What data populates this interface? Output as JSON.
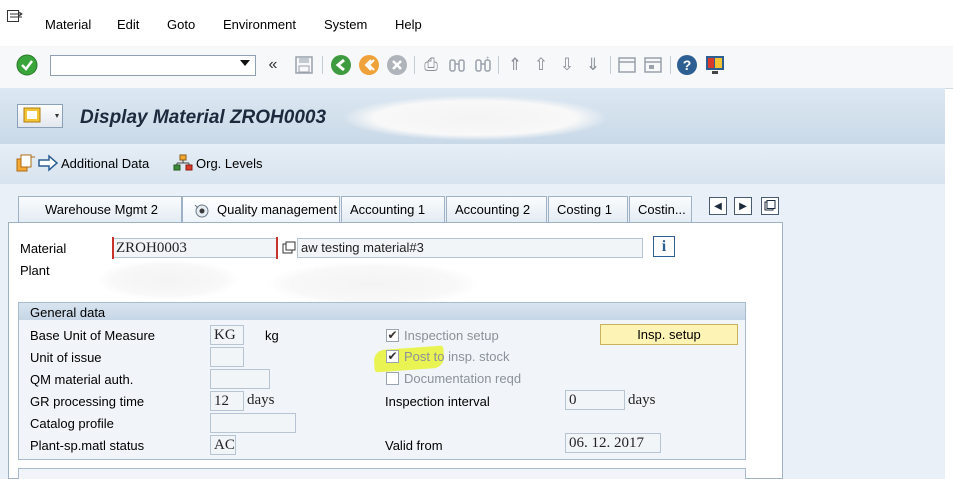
{
  "menu": {
    "items": [
      {
        "label": "Material"
      },
      {
        "label": "Edit"
      },
      {
        "label": "Goto"
      },
      {
        "label": "Environment"
      },
      {
        "label": "System"
      },
      {
        "label": "Help"
      }
    ]
  },
  "toolbar": {
    "command_field_value": "",
    "back_glyph": "«"
  },
  "title": {
    "text": "Display Material ZROH0003"
  },
  "app_toolbar": {
    "additional_data_label": "Additional Data",
    "org_levels_label": "Org. Levels"
  },
  "tabs": [
    {
      "label": "Warehouse Mgmt 2",
      "active": false
    },
    {
      "label": "Quality management",
      "active": true
    },
    {
      "label": "Accounting 1",
      "active": false
    },
    {
      "label": "Accounting 2",
      "active": false
    },
    {
      "label": "Costing 1",
      "active": false
    },
    {
      "label": "Costin...",
      "active": false
    }
  ],
  "header_fields": {
    "material_label": "Material",
    "material_value": "ZROH0003",
    "material_desc": "aw testing material#3",
    "plant_label": "Plant"
  },
  "general_data": {
    "title": "General data",
    "base_uom_label": "Base Unit of Measure",
    "base_uom_value": "KG",
    "base_uom_text": "kg",
    "unit_issue_label": "Unit of issue",
    "unit_issue_value": "",
    "qm_auth_label": "QM material auth.",
    "qm_auth_value": "",
    "gr_time_label": "GR processing time",
    "gr_time_value": "12",
    "gr_time_unit": "days",
    "catalog_label": "Catalog profile",
    "catalog_value": "",
    "status_label": "Plant-sp.matl status",
    "status_value": "AC",
    "insp_setup_cb_label": "Inspection setup",
    "insp_setup_checked": true,
    "post_insp_label": "Post to insp. stock",
    "post_insp_checked": true,
    "doc_reqd_label": "Documentation reqd",
    "doc_reqd_checked": false,
    "insp_setup_button": "Insp. setup",
    "interval_label": "Inspection interval",
    "interval_value": "0",
    "interval_unit": "days",
    "valid_from_label": "Valid from",
    "valid_from_value": "06. 12. 2017"
  },
  "colors": {
    "accent_blue": "#2a4f7c",
    "button_yellow": "#fdf3b5",
    "highlight": "#e6f21a",
    "check_green": "#3aa53a"
  }
}
